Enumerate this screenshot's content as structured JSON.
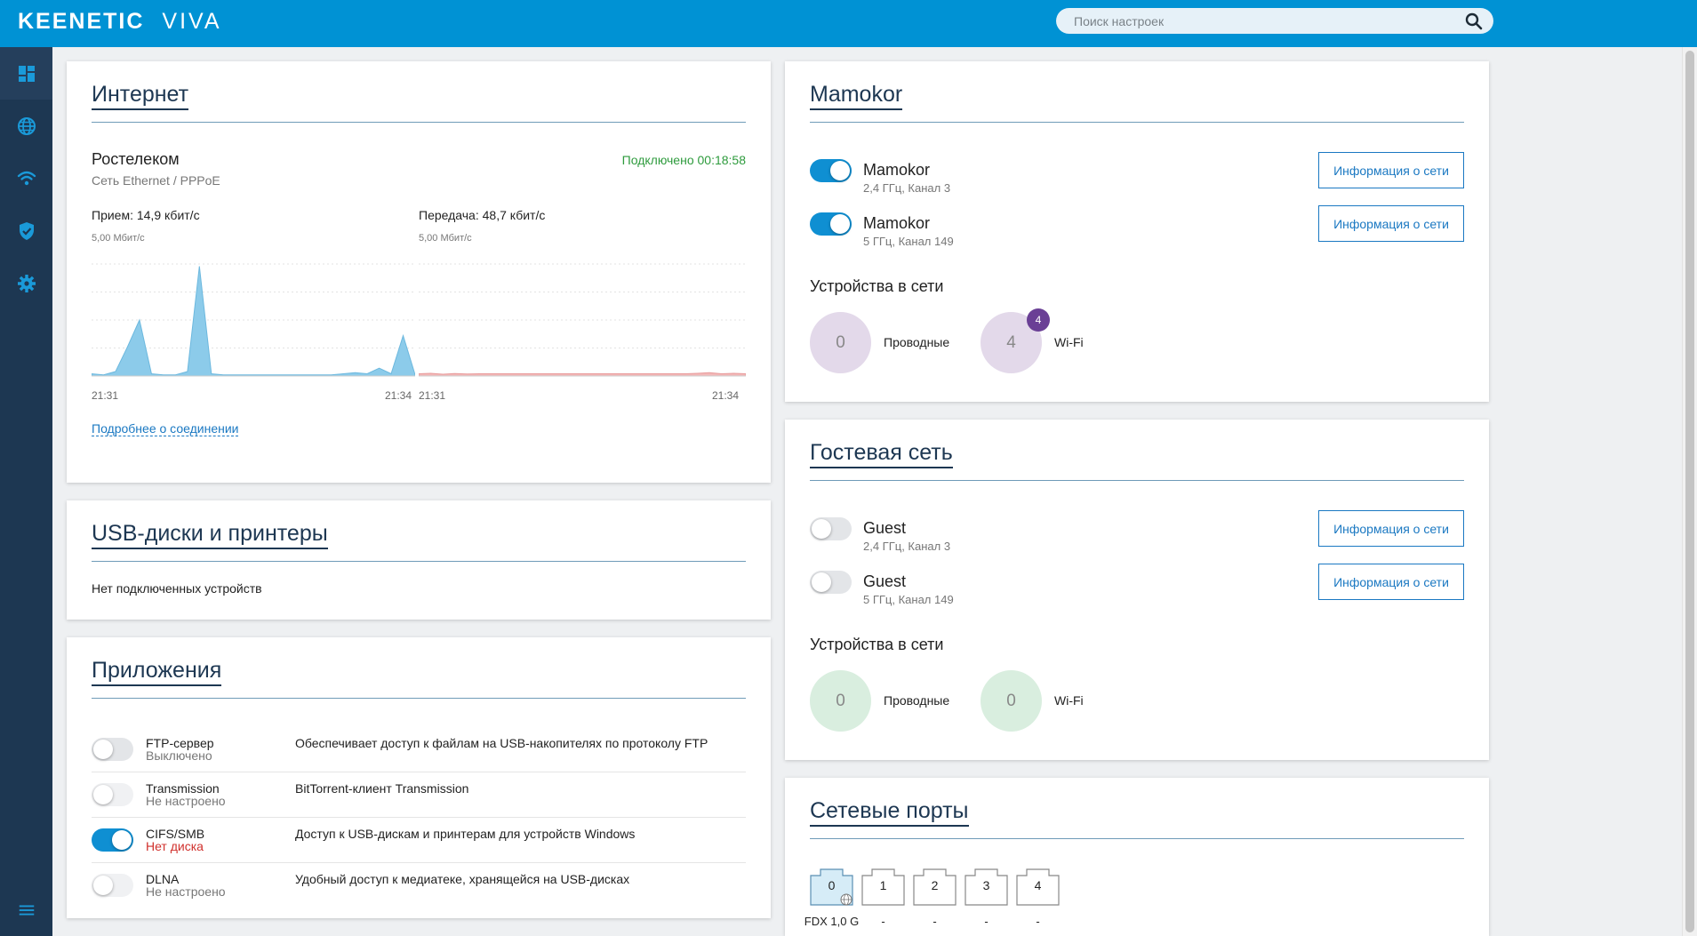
{
  "header": {
    "brand": "KEENETIC",
    "model": "VIVA",
    "search_placeholder": "Поиск настроек"
  },
  "sidebar": {
    "items": [
      {
        "name": "dashboard-icon",
        "active": true
      },
      {
        "name": "globe-icon",
        "active": false
      },
      {
        "name": "wifi-icon",
        "active": false
      },
      {
        "name": "shield-icon",
        "active": false
      },
      {
        "name": "gear-icon",
        "active": false
      }
    ],
    "menu_icon": "hamburger-icon"
  },
  "internet": {
    "title": "Интернет",
    "provider": "Ростелеком",
    "type": "Сеть Ethernet / PPPoE",
    "status": "Подключено 00:18:58",
    "status_color": "#2e9b3d",
    "rx_label": "Прием: 14,9 кбит/с",
    "tx_label": "Передача: 48,7 кбит/с",
    "rx_scale": "5,00 Мбит/с",
    "tx_scale": "5,00 Мбит/с",
    "rx_start": "21:31",
    "rx_end": "21:34",
    "tx_start": "21:31",
    "tx_end": "21:34",
    "more_link": "Подробнее о соединении"
  },
  "chart_data": [
    {
      "type": "area",
      "series": [
        {
          "values": [
            0.1,
            0.05,
            0.2,
            1.3,
            2.5,
            0.1,
            0.05,
            0.05,
            0.2,
            4.9,
            0.1,
            0.05,
            0.05,
            0.05,
            0.05,
            0.05,
            0.05,
            0.05,
            0.05,
            0.05,
            0.05,
            0.1,
            0.15,
            0.1,
            0.35,
            0.1,
            1.8,
            0.05
          ]
        }
      ],
      "ylim": [
        0,
        5
      ],
      "color": "#8ccbea"
    },
    {
      "type": "area",
      "series": [
        {
          "values": [
            0.1,
            0.12,
            0.08,
            0.11,
            0.09,
            0.1,
            0.1,
            0.1,
            0.1,
            0.1,
            0.1,
            0.1,
            0.1,
            0.1,
            0.1,
            0.1,
            0.1,
            0.1,
            0.1,
            0.1,
            0.1,
            0.1,
            0.1,
            0.12,
            0.15,
            0.1,
            0.12,
            0.1
          ]
        }
      ],
      "ylim": [
        0,
        5
      ],
      "color": "#f2b8b8"
    }
  ],
  "usb": {
    "title": "USB-диски и принтеры",
    "empty": "Нет подключенных устройств"
  },
  "apps": {
    "title": "Приложения",
    "rows": [
      {
        "name": "FTP-сервер",
        "state": "Выключено",
        "desc": "Обеспечивает доступ к файлам на USB-накопителях по протоколу FTP",
        "on": false
      },
      {
        "name": "Transmission",
        "state": "Не настроено",
        "desc": "BitTorrent-клиент Transmission",
        "on": false
      },
      {
        "name": "CIFS/SMB",
        "state": "Нет диска",
        "desc": "Доступ к USB-дискам и принтерам для устройств Windows",
        "on": true
      },
      {
        "name": "DLNA",
        "state": "Не настроено",
        "desc": "Удобный доступ к медиатеке, хранящейся на USB-дисках",
        "on": false
      }
    ]
  },
  "home_network": {
    "title": "Mamokor",
    "networks": [
      {
        "name": "Mamokor",
        "band": "2,4 ГГц, Канал 3",
        "on": true,
        "button": "Информация о сети"
      },
      {
        "name": "Mamokor",
        "band": "5 ГГц, Канал 149",
        "on": true,
        "button": "Информация о сети"
      }
    ],
    "devices_heading": "Устройства в сети",
    "wired_count": "0",
    "wired_label": "Проводные",
    "wifi_count": "4",
    "wifi_badge": "4",
    "wifi_label": "Wi-Fi"
  },
  "guest_network": {
    "title": "Гостевая сеть",
    "networks": [
      {
        "name": "Guest",
        "band": "2,4 ГГц, Канал 3",
        "on": false,
        "button": "Информация о сети"
      },
      {
        "name": "Guest",
        "band": "5 ГГц, Канал 149",
        "on": false,
        "button": "Информация о сети"
      }
    ],
    "devices_heading": "Устройства в сети",
    "wired_count": "0",
    "wired_label": "Проводные",
    "wifi_count": "0",
    "wifi_label": "Wi-Fi"
  },
  "ports": {
    "title": "Сетевые порты",
    "items": [
      {
        "num": "0",
        "info": "FDX 1,0 G",
        "active": true
      },
      {
        "num": "1",
        "info": "-",
        "active": false
      },
      {
        "num": "2",
        "info": "-",
        "active": false
      },
      {
        "num": "3",
        "info": "-",
        "active": false
      },
      {
        "num": "4",
        "info": "-",
        "active": false
      }
    ]
  },
  "colors": {
    "header": "#0092d4",
    "sidebar": "#1d3752",
    "accent": "#1a78c2"
  }
}
